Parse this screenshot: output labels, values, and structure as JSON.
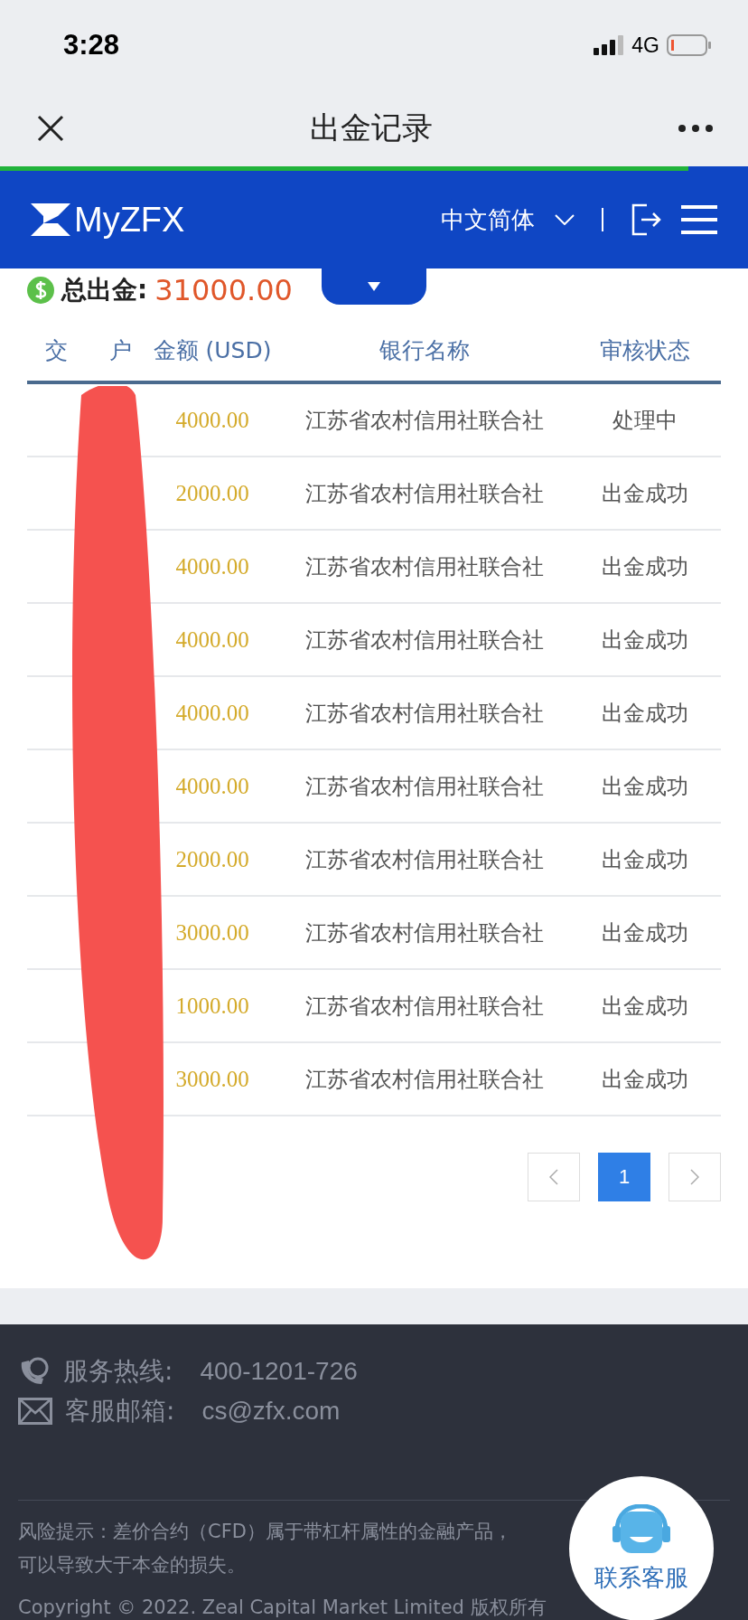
{
  "status_bar": {
    "time": "3:28",
    "network": "4G"
  },
  "nav": {
    "title": "出金记录"
  },
  "load_progress": {
    "level": 0.92
  },
  "header": {
    "logo": "MyZFX",
    "language": "中文简体"
  },
  "summary": {
    "label": "总出金:",
    "amount": "31000.00"
  },
  "table": {
    "columns": [
      {
        "parts": [
          "交",
          "户"
        ],
        "redacted": true
      },
      {
        "label": "金额 (USD)"
      },
      {
        "label": "银行名称"
      },
      {
        "label": "审核状态"
      }
    ],
    "rows": [
      {
        "amount": "4000.00",
        "bank": "江苏省农村信用社联合社",
        "status": "处理中"
      },
      {
        "amount": "2000.00",
        "bank": "江苏省农村信用社联合社",
        "status": "出金成功"
      },
      {
        "amount": "4000.00",
        "bank": "江苏省农村信用社联合社",
        "status": "出金成功"
      },
      {
        "amount": "4000.00",
        "bank": "江苏省农村信用社联合社",
        "status": "出金成功"
      },
      {
        "amount": "4000.00",
        "bank": "江苏省农村信用社联合社",
        "status": "出金成功"
      },
      {
        "amount": "4000.00",
        "bank": "江苏省农村信用社联合社",
        "status": "出金成功"
      },
      {
        "amount": "2000.00",
        "bank": "江苏省农村信用社联合社",
        "status": "出金成功"
      },
      {
        "amount": "3000.00",
        "bank": "江苏省农村信用社联合社",
        "status": "出金成功"
      },
      {
        "amount": "1000.00",
        "bank": "江苏省农村信用社联合社",
        "status": "出金成功"
      },
      {
        "amount": "3000.00",
        "bank": "江苏省农村信用社联合社",
        "status": "出金成功"
      }
    ]
  },
  "pagination": {
    "pages": [
      {
        "label": "1",
        "selected": true
      }
    ]
  },
  "footer": {
    "hotline_label": "服务热线:",
    "hotline": "400-1201-726",
    "email_label": "客服邮箱:",
    "email": "cs@zfx.com",
    "risk": "风险提示：差价合约（CFD）属于带杠杆属性的金融产品，",
    "risk_2": "可以导致大于本金的损失。",
    "copyright": "Copyright © 2022. Zeal Capital Market Limited 版权所有"
  },
  "chat_button": {
    "label": "联系客服"
  }
}
